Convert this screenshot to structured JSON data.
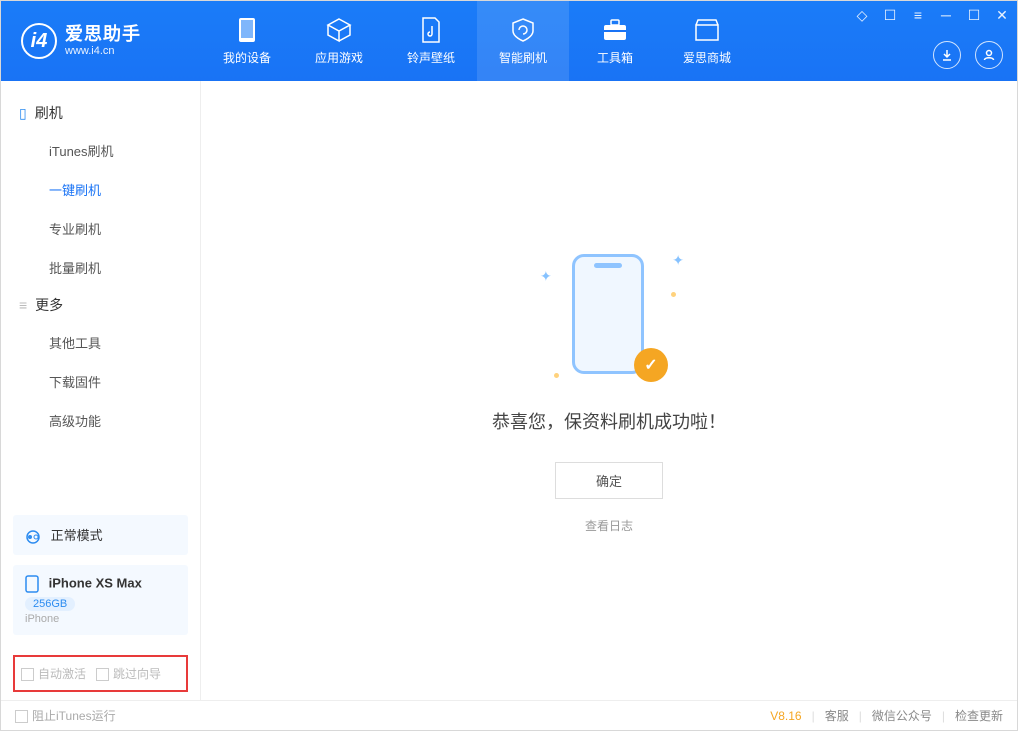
{
  "app": {
    "title": "爱思助手",
    "url": "www.i4.cn"
  },
  "nav": {
    "items": [
      {
        "label": "我的设备"
      },
      {
        "label": "应用游戏"
      },
      {
        "label": "铃声壁纸"
      },
      {
        "label": "智能刷机"
      },
      {
        "label": "工具箱"
      },
      {
        "label": "爱思商城"
      }
    ],
    "active_index": 3
  },
  "sidebar": {
    "group1": {
      "label": "刷机"
    },
    "items1": [
      {
        "label": "iTunes刷机"
      },
      {
        "label": "一键刷机"
      },
      {
        "label": "专业刷机"
      },
      {
        "label": "批量刷机"
      }
    ],
    "active1": 1,
    "group2": {
      "label": "更多"
    },
    "items2": [
      {
        "label": "其他工具"
      },
      {
        "label": "下载固件"
      },
      {
        "label": "高级功能"
      }
    ]
  },
  "device": {
    "mode_label": "正常模式",
    "name": "iPhone XS Max",
    "storage": "256GB",
    "type": "iPhone"
  },
  "options": {
    "auto_activate": "自动激活",
    "skip_guide": "跳过向导"
  },
  "main": {
    "success_message": "恭喜您，保资料刷机成功啦！",
    "ok_btn": "确定",
    "view_log": "查看日志"
  },
  "footer": {
    "block_itunes": "阻止iTunes运行",
    "version": "V8.16",
    "support": "客服",
    "wechat": "微信公众号",
    "update": "检查更新"
  }
}
